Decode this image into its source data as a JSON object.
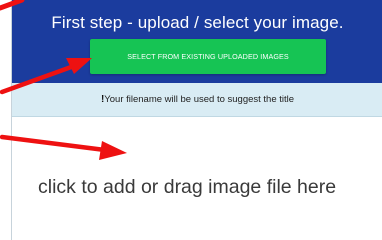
{
  "header": {
    "title": "First step - upload / select your image."
  },
  "select_button": {
    "label": "SELECT FROM EXISTING UPLOADED IMAGES"
  },
  "notice": {
    "icon": "!",
    "text": "Your filename will be used to suggest the title"
  },
  "dropzone": {
    "text": "click to add or drag image file here"
  },
  "colors": {
    "header_bg": "#1b3c9e",
    "button_bg": "#16c454",
    "notice_bg": "#d9ecf4",
    "annotation_arrow": "#ee1111"
  }
}
